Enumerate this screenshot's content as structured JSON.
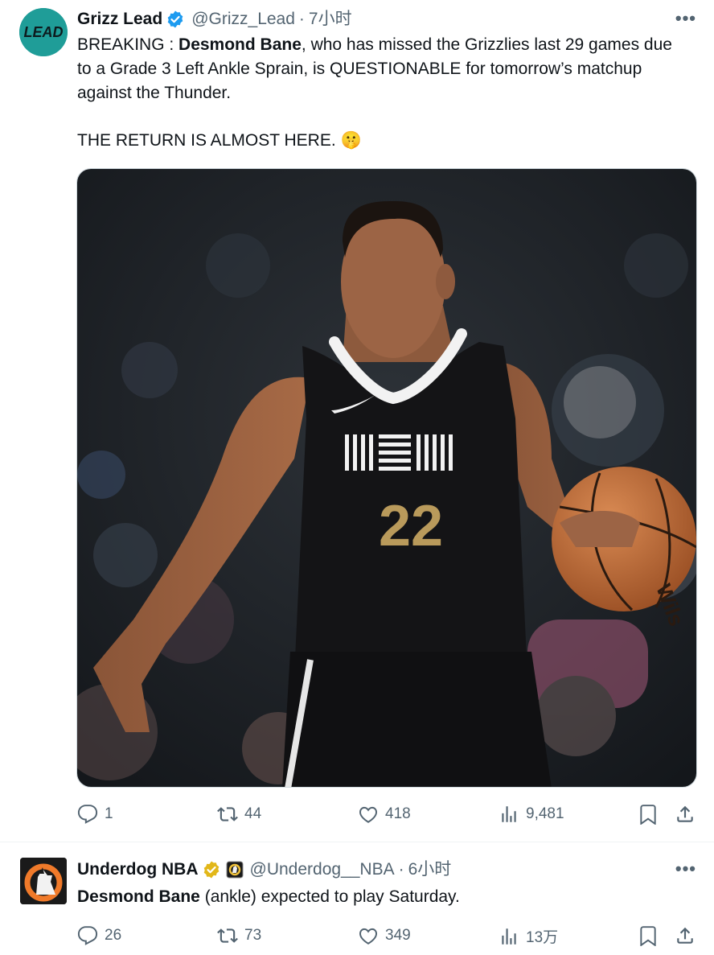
{
  "tweets": [
    {
      "author": "Grizz Lead",
      "handle": "@Grizz_Lead",
      "dot": "·",
      "time": "7小时",
      "avatar_text": "LEAD",
      "text": {
        "prefix": "BREAKING : ",
        "bold": "Desmond Bane",
        "rest": ", who has missed the Grizzlies last 29 games due to a Grade 3 Left Ankle Sprain, is QUESTIONABLE for tomorrow’s matchup against the Thunder.",
        "line2": "THE RETURN IS ALMOST HERE. 🤫"
      },
      "media": {
        "jersey_number": "22",
        "ball_text": "Wils"
      },
      "actions": {
        "replies": "1",
        "retweets": "44",
        "likes": "418",
        "views": "9,481"
      },
      "verified_color": "#1d9bf0"
    },
    {
      "author": "Underdog NBA",
      "handle": "@Underdog__NBA",
      "dot": "·",
      "time": "6小时",
      "text": {
        "bold": "Desmond Bane",
        "rest": " (ankle) expected to play Saturday."
      },
      "actions": {
        "replies": "26",
        "retweets": "73",
        "likes": "349",
        "views": "13万"
      },
      "verified_color": "#e2b719"
    }
  ],
  "colors": {
    "text": "#0f1419",
    "muted": "#536471",
    "divider": "#eff3f4"
  }
}
